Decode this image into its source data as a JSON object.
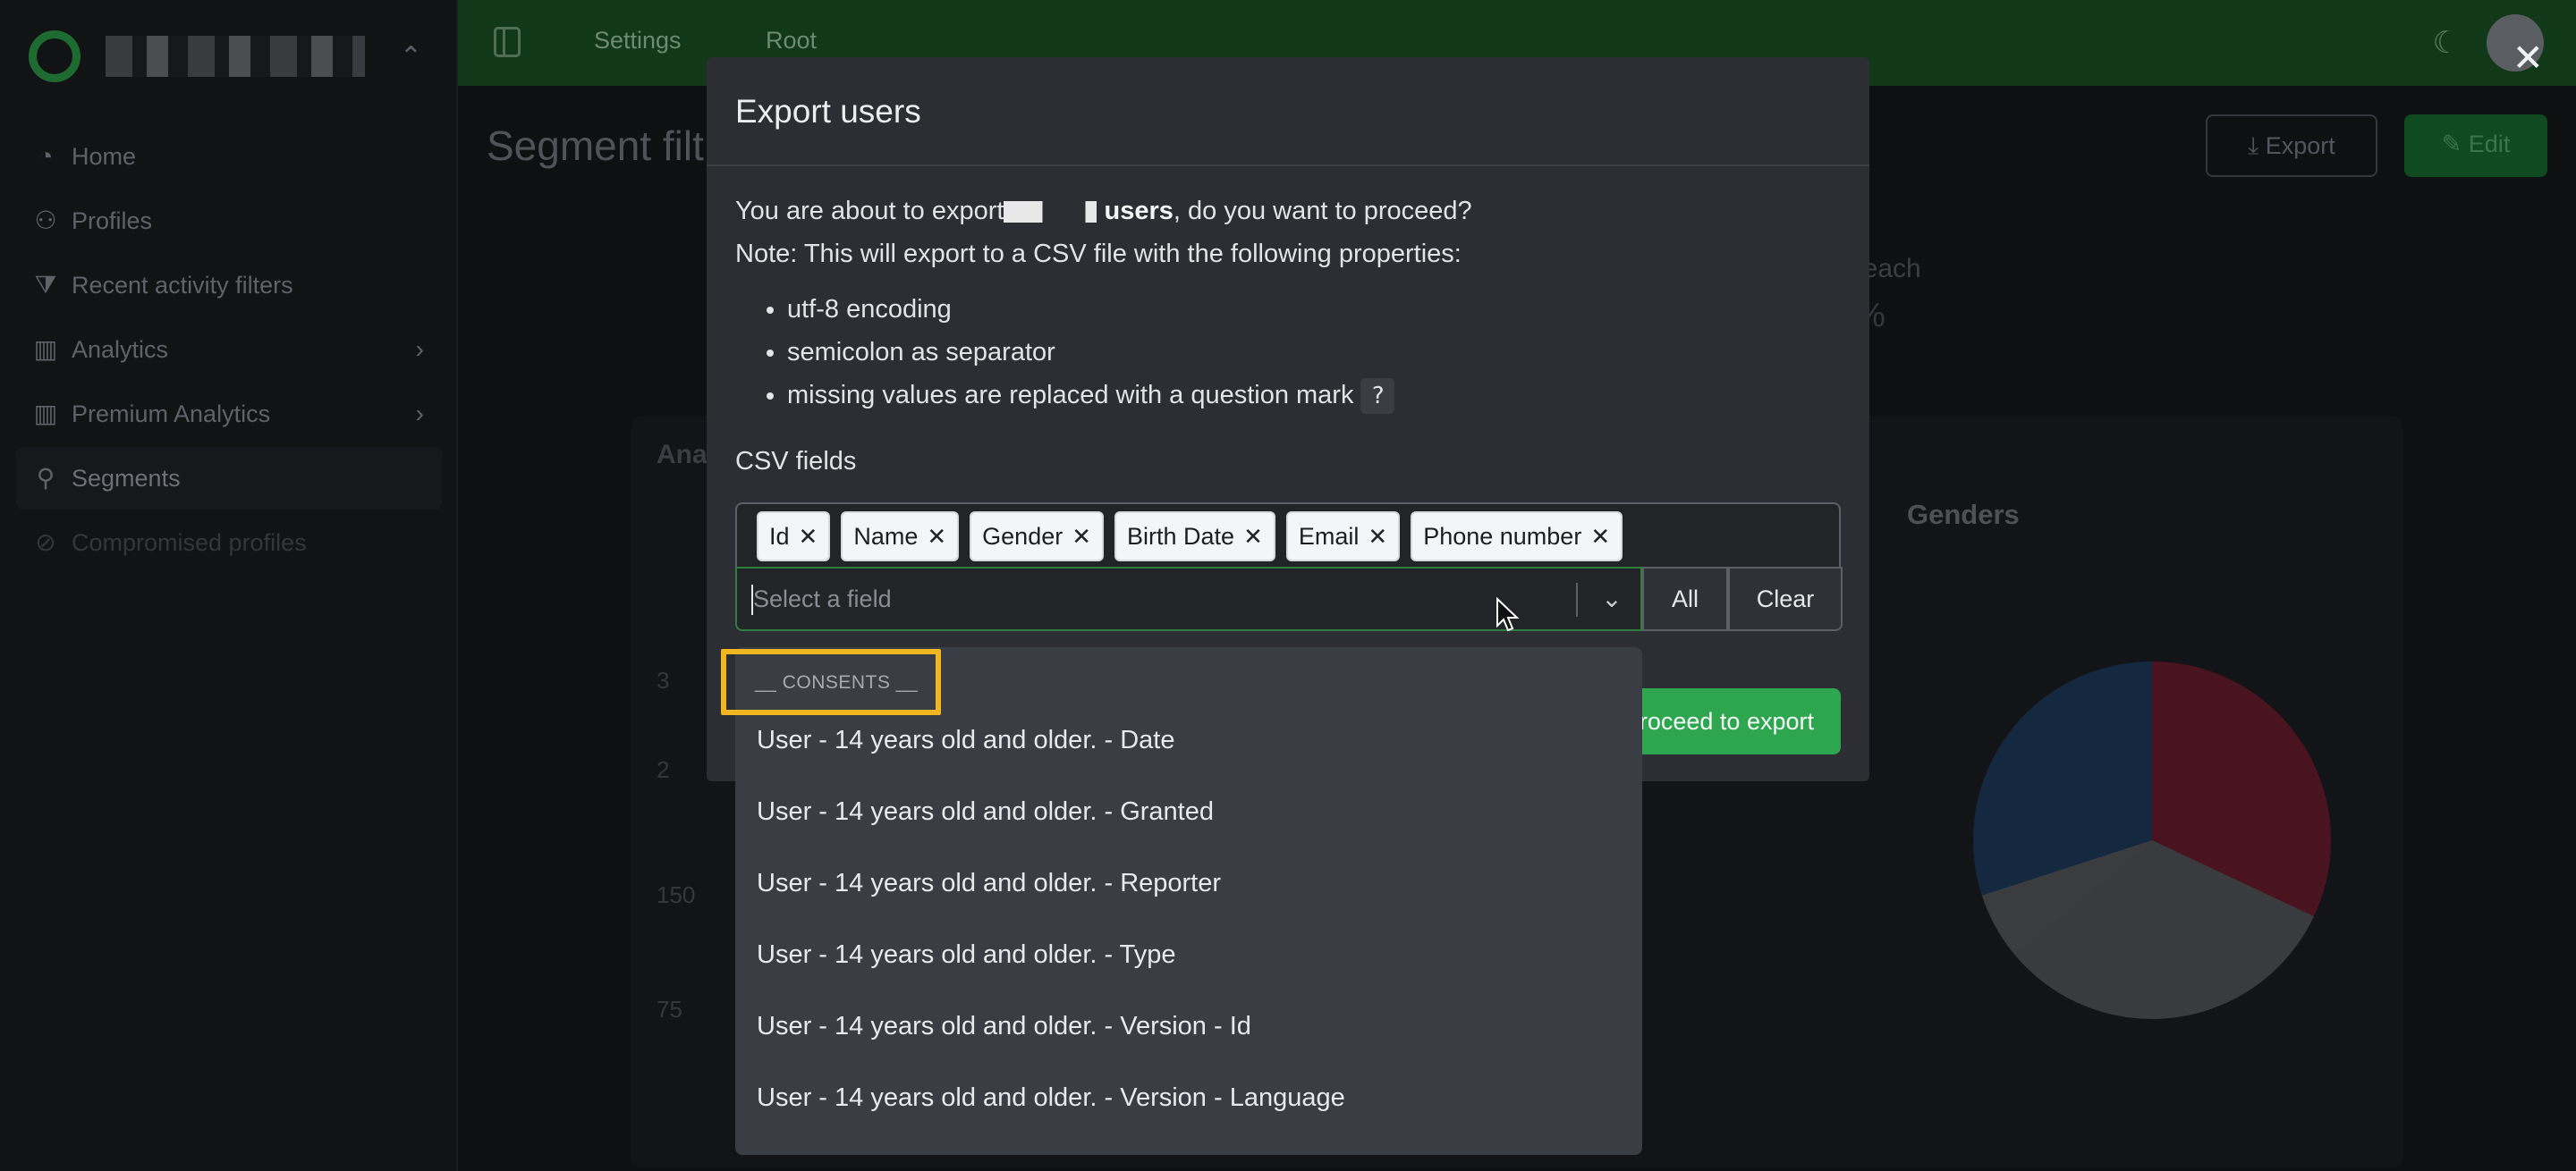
{
  "sidebar": {
    "items": [
      {
        "label": "Home",
        "icon": "gauge-icon",
        "glyph": "◔"
      },
      {
        "label": "Profiles",
        "icon": "users-icon",
        "glyph": "⚇"
      },
      {
        "label": "Recent activity filters",
        "icon": "filter-icon",
        "glyph": "⧩"
      },
      {
        "label": "Analytics",
        "icon": "bar-chart-icon",
        "glyph": "▥"
      },
      {
        "label": "Premium Analytics",
        "icon": "bar-chart-icon",
        "glyph": "▥"
      },
      {
        "label": "Segments",
        "icon": "pin-icon",
        "glyph": "⚲"
      },
      {
        "label": "Compromised profiles",
        "icon": "ban-icon",
        "glyph": "⊘"
      }
    ]
  },
  "topbar": {
    "nav": [
      "Settings",
      "Root"
    ]
  },
  "content": {
    "title": "Segment filt",
    "export_label": "Export",
    "edit_label": "Edit",
    "kpi_label": "t reach",
    "kpi_value": "%",
    "panel_title": "Ana",
    "ticks": [
      "3",
      "2",
      "150",
      "75"
    ],
    "chart_title": "Genders"
  },
  "modal": {
    "title": "Export users",
    "intro_before": "You are about to export",
    "intro_users": "users",
    "intro_after": ", do you want to proceed?",
    "note": "Note: This will export to a CSV file with the following properties:",
    "props": [
      "utf-8 encoding",
      "semicolon as separator",
      "missing values are replaced with a question mark"
    ],
    "question_mark": "?",
    "csv_label": "CSV fields",
    "tags": [
      "Id",
      "Name",
      "Gender",
      "Birth Date",
      "Email",
      "Phone number"
    ],
    "remove_glyph": "✕",
    "select_placeholder": "Select a field",
    "all_label": "All",
    "clear_label": "Clear",
    "proceed_label": "Proceed to export",
    "close_glyph": "✕"
  },
  "dropdown": {
    "group": "__ CONSENTS __",
    "options": [
      "User - 14 years old and older. - Date",
      "User - 14 years old and older. - Granted",
      "User - 14 years old and older. - Reporter",
      "User - 14 years old and older. - Type",
      "User - 14 years old and older. - Version - Id",
      "User - 14 years old and older. - Version - Language"
    ]
  }
}
